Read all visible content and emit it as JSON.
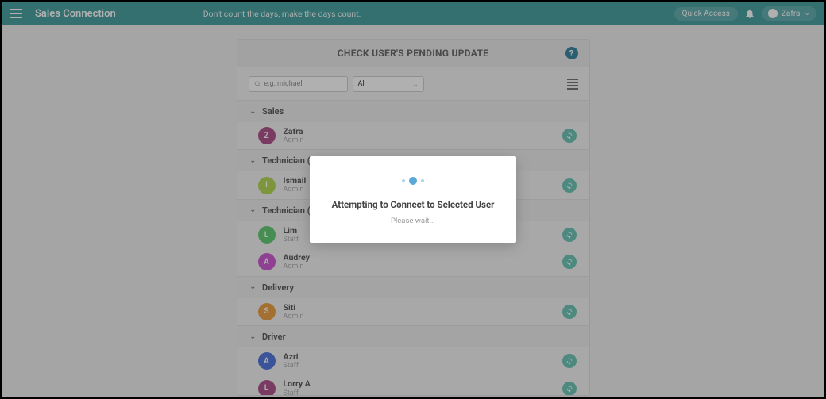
{
  "header": {
    "brand": "Sales Connection",
    "tagline": "Don't count the days, make the days count.",
    "quick_access": "Quick Access",
    "user_name": "Zafra"
  },
  "panel": {
    "title": "CHECK USER'S PENDING UPDATE"
  },
  "toolbar": {
    "search_placeholder": "e.g: michael",
    "filter_value": "All"
  },
  "groups": [
    {
      "name": "Sales",
      "users": [
        {
          "initial": "Z",
          "name": "Zafra",
          "role": "Admin",
          "color": "#9c2a6f"
        }
      ]
    },
    {
      "name": "Technician (KL)",
      "users": [
        {
          "initial": "I",
          "name": "Ismail",
          "role": "Admin",
          "color": "#a4cf2a"
        }
      ]
    },
    {
      "name": "Technician (Johor)",
      "users": [
        {
          "initial": "L",
          "name": "Lim",
          "role": "Staff",
          "color": "#3fbf53"
        },
        {
          "initial": "A",
          "name": "Audrey",
          "role": "Admin",
          "color": "#c233c8"
        }
      ]
    },
    {
      "name": "Delivery",
      "users": [
        {
          "initial": "S",
          "name": "Siti",
          "role": "Admin",
          "color": "#e88a1a"
        }
      ]
    },
    {
      "name": "Driver",
      "users": [
        {
          "initial": "A",
          "name": "Azri",
          "role": "Staff",
          "color": "#2957d6"
        },
        {
          "initial": "L",
          "name": "Lorry A",
          "role": "Staff",
          "color": "#9c2a6f"
        }
      ]
    }
  ],
  "modal": {
    "title": "Attempting to Connect to Selected User",
    "subtitle": "Please wait..."
  }
}
